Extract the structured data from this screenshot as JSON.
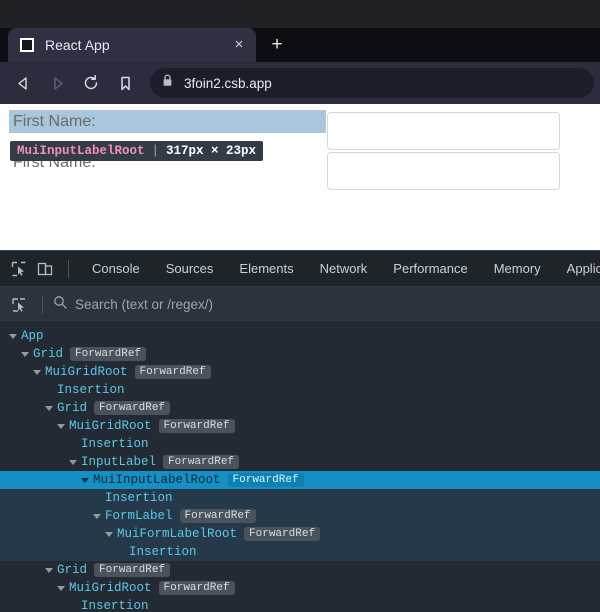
{
  "browser": {
    "tab": {
      "title": "React App",
      "favicon_icon": "square-favicon-icon",
      "close_icon": "×"
    },
    "newtab_label": "+",
    "nav": {
      "back_icon": "back-arrow-icon",
      "forward_icon": "forward-arrow-icon",
      "reload_icon": "reload-icon",
      "bookmark_icon": "bookmark-icon"
    },
    "omnibox": {
      "lock_icon": "lock-icon",
      "url": "3foin2.csb.app"
    }
  },
  "page": {
    "label_1": "First Name:",
    "label_2": "First Name:",
    "input_1_value": "",
    "input_2_value": "",
    "input_placeholder": "",
    "highlight_color": "#a8c7dd",
    "tooltip": {
      "component": "MuiInputLabelRoot",
      "separator": "|",
      "dimensions": "317px × 23px"
    }
  },
  "devtools": {
    "inspect_icon": "inspect-element-icon",
    "device_icon": "device-toolbar-icon",
    "tabs": [
      {
        "label": "Console"
      },
      {
        "label": "Sources"
      },
      {
        "label": "Elements"
      },
      {
        "label": "Network"
      },
      {
        "label": "Performance"
      },
      {
        "label": "Memory"
      },
      {
        "label": "Application"
      }
    ],
    "search": {
      "picker_icon": "component-picker-icon",
      "search_icon": "search-icon",
      "placeholder": "Search (text or /regex/)",
      "value": ""
    },
    "tree": [
      {
        "name": "App",
        "badge": "",
        "depth": 0,
        "arrow": true,
        "state": "none"
      },
      {
        "name": "Grid",
        "badge": "ForwardRef",
        "depth": 1,
        "arrow": true,
        "state": "none"
      },
      {
        "name": "MuiGridRoot",
        "badge": "ForwardRef",
        "depth": 2,
        "arrow": true,
        "state": "none"
      },
      {
        "name": "Insertion",
        "badge": "",
        "depth": 3,
        "arrow": false,
        "state": "none"
      },
      {
        "name": "Grid",
        "badge": "ForwardRef",
        "depth": 3,
        "arrow": true,
        "state": "none"
      },
      {
        "name": "MuiGridRoot",
        "badge": "ForwardRef",
        "depth": 4,
        "arrow": true,
        "state": "none"
      },
      {
        "name": "Insertion",
        "badge": "",
        "depth": 5,
        "arrow": false,
        "state": "none"
      },
      {
        "name": "InputLabel",
        "badge": "ForwardRef",
        "depth": 5,
        "arrow": true,
        "state": "none"
      },
      {
        "name": "MuiInputLabelRoot",
        "badge": "ForwardRef",
        "depth": 6,
        "arrow": true,
        "state": "selected"
      },
      {
        "name": "Insertion",
        "badge": "",
        "depth": 7,
        "arrow": false,
        "state": "subtree"
      },
      {
        "name": "FormLabel",
        "badge": "ForwardRef",
        "depth": 7,
        "arrow": true,
        "state": "subtree"
      },
      {
        "name": "MuiFormLabelRoot",
        "badge": "ForwardRef",
        "depth": 8,
        "arrow": true,
        "state": "subtree"
      },
      {
        "name": "Insertion",
        "badge": "",
        "depth": 9,
        "arrow": false,
        "state": "subtree"
      },
      {
        "name": "Grid",
        "badge": "ForwardRef",
        "depth": 3,
        "arrow": true,
        "state": "none"
      },
      {
        "name": "MuiGridRoot",
        "badge": "ForwardRef",
        "depth": 4,
        "arrow": true,
        "state": "none"
      },
      {
        "name": "Insertion",
        "badge": "",
        "depth": 5,
        "arrow": false,
        "state": "none"
      }
    ]
  }
}
